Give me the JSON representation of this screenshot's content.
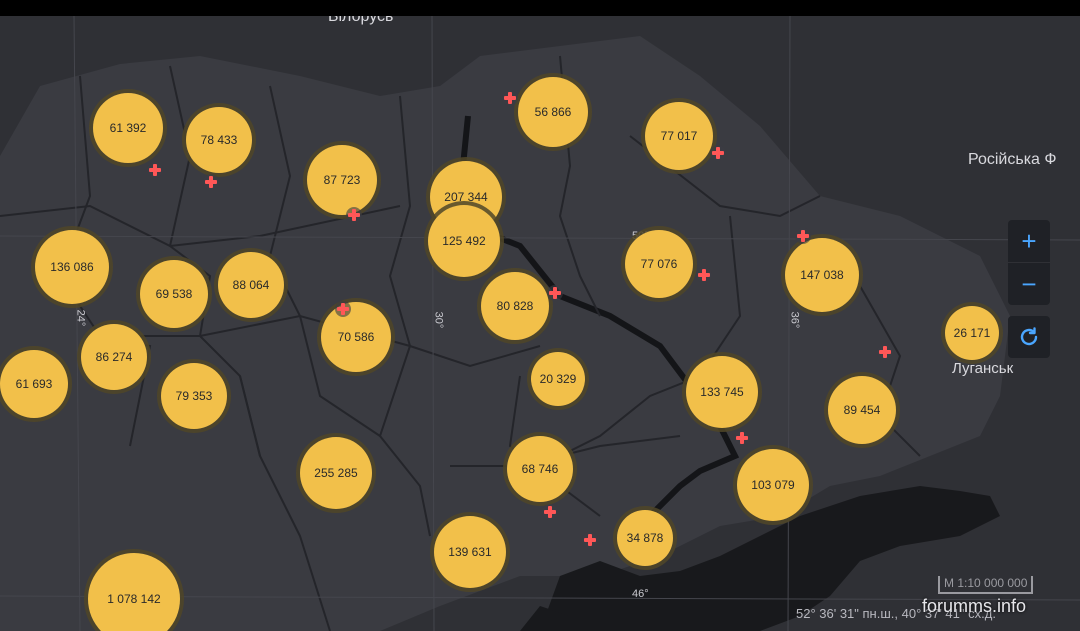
{
  "map": {
    "labels": {
      "top_country": "Білорусь",
      "right_country": "Російська Ф",
      "city": "Луганськ"
    },
    "grid_labels": {
      "lon_24": "24°",
      "lon_30": "30°",
      "lon_36": "36°",
      "lat_50": "50°",
      "lat_46": "46°"
    },
    "clusters": [
      {
        "value": "61 392"
      },
      {
        "value": "78 433"
      },
      {
        "value": "87 723"
      },
      {
        "value": "207 344"
      },
      {
        "value": "125 492"
      },
      {
        "value": "56 866"
      },
      {
        "value": "77 017"
      },
      {
        "value": "136 086"
      },
      {
        "value": "69 538"
      },
      {
        "value": "88 064"
      },
      {
        "value": "70 586"
      },
      {
        "value": "80 828"
      },
      {
        "value": "77 076"
      },
      {
        "value": "147 038"
      },
      {
        "value": "26 171"
      },
      {
        "value": "61 693"
      },
      {
        "value": "86 274"
      },
      {
        "value": "79 353"
      },
      {
        "value": "20 329"
      },
      {
        "value": "133 745"
      },
      {
        "value": "89 454"
      },
      {
        "value": "255 285"
      },
      {
        "value": "68 746"
      },
      {
        "value": "103 079"
      },
      {
        "value": "139 631"
      },
      {
        "value": "34 878"
      },
      {
        "value": "1 078 142"
      }
    ],
    "marker_icon": "red-cross-icon"
  },
  "controls": {
    "zoom_in": "+",
    "zoom_out": "−",
    "refresh_icon": "refresh-icon"
  },
  "footer": {
    "scale": "M 1:10 000 000",
    "coords": "52° 36' 31\" пн.ш., 40° 37' 41\" сх.д.",
    "watermark": "forumms.info"
  },
  "colors": {
    "background": "#2f3035",
    "cluster_fill": "#f2c04a",
    "marker": "#ff5757",
    "control_icon": "#4aa6ff"
  }
}
